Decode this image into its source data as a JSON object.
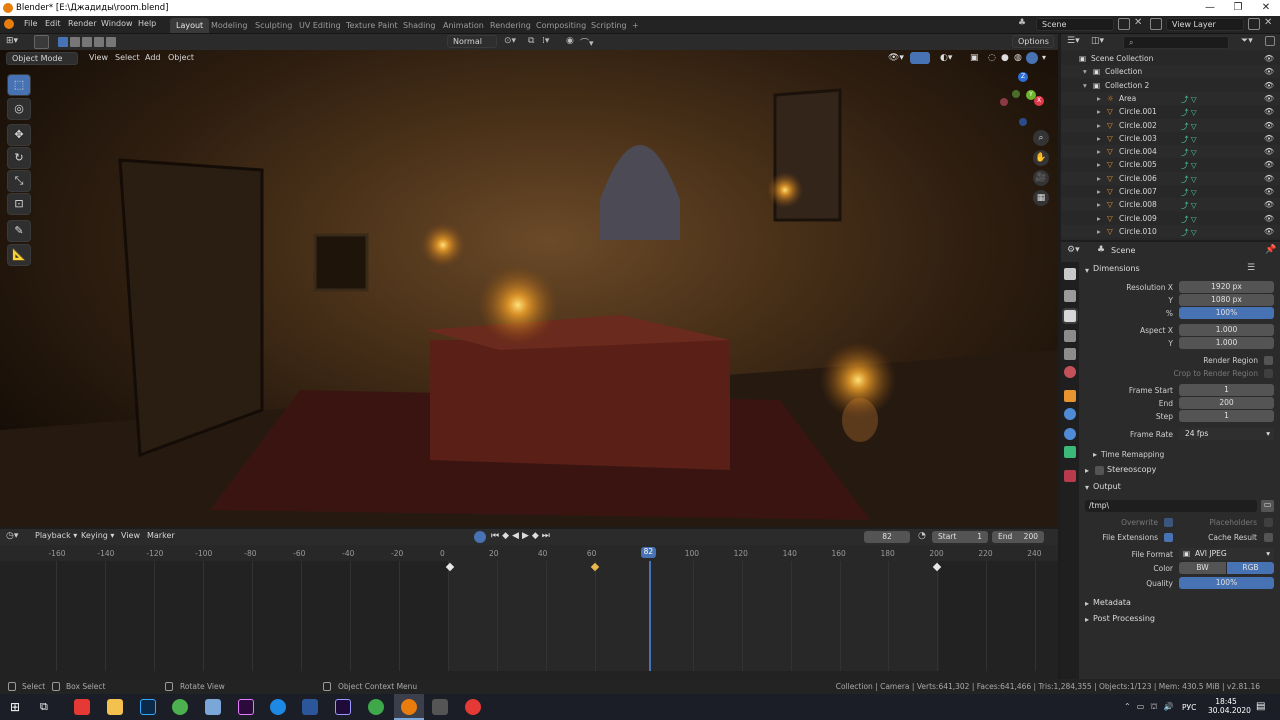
{
  "window": {
    "title": "Blender* [E:\\Джадиды\\room.blend]"
  },
  "topbar": {
    "menus": [
      "File",
      "Edit",
      "Render",
      "Window",
      "Help"
    ],
    "workspaces": [
      "Layout",
      "Modeling",
      "Sculpting",
      "UV Editing",
      "Texture Paint",
      "Shading",
      "Animation",
      "Rendering",
      "Compositing",
      "Scripting"
    ],
    "add_tab": "+",
    "scene_label": "Scene",
    "view_layer_label": "View Layer"
  },
  "viewport_header": {
    "orientation": "Normal",
    "options": "Options",
    "mode": "Object Mode",
    "menus": [
      "View",
      "Select",
      "Add",
      "Object"
    ]
  },
  "gizmo": {
    "x": "X",
    "y": "Y",
    "z": "Z"
  },
  "timeline": {
    "menus": [
      "Playback",
      "Keying",
      "View",
      "Marker"
    ],
    "current_frame": "82",
    "start_label": "Start",
    "start": "1",
    "end_label": "End",
    "end": "200",
    "ticks": [
      "-160",
      "-140",
      "-120",
      "-100",
      "-80",
      "-60",
      "-40",
      "-20",
      "0",
      "20",
      "40",
      "60",
      "82",
      "100",
      "120",
      "140",
      "160",
      "180",
      "200",
      "220",
      "240"
    ],
    "keyframes": [
      1,
      60,
      200
    ],
    "playhead_frame": 82
  },
  "outliner": {
    "search_placeholder": "",
    "rows": [
      {
        "name": "Scene Collection",
        "indent": 0
      },
      {
        "name": "Collection",
        "indent": 1
      },
      {
        "name": "Collection 2",
        "indent": 1
      },
      {
        "name": "Area",
        "indent": 2
      },
      {
        "name": "Circle.001",
        "indent": 2
      },
      {
        "name": "Circle.002",
        "indent": 2
      },
      {
        "name": "Circle.003",
        "indent": 2
      },
      {
        "name": "Circle.004",
        "indent": 2
      },
      {
        "name": "Circle.005",
        "indent": 2
      },
      {
        "name": "Circle.006",
        "indent": 2
      },
      {
        "name": "Circle.007",
        "indent": 2
      },
      {
        "name": "Circle.008",
        "indent": 2
      },
      {
        "name": "Circle.009",
        "indent": 2
      },
      {
        "name": "Circle.010",
        "indent": 2
      }
    ]
  },
  "properties": {
    "context": "Scene",
    "dimensions": {
      "header": "Dimensions",
      "res_x_label": "Resolution X",
      "res_x": "1920 px",
      "res_y_label": "Y",
      "res_y": "1080 px",
      "res_pct_label": "%",
      "res_pct": "100%",
      "aspect_x_label": "Aspect X",
      "aspect_x": "1.000",
      "aspect_y_label": "Y",
      "aspect_y": "1.000",
      "render_region": "Render Region",
      "crop_region": "Crop to Render Region",
      "frame_start_label": "Frame Start",
      "frame_start": "1",
      "end_label": "End",
      "end": "200",
      "step_label": "Step",
      "step": "1",
      "frame_rate_label": "Frame Rate",
      "frame_rate": "24 fps",
      "time_remapping": "Time Remapping"
    },
    "stereoscopy": "Stereoscopy",
    "output": {
      "header": "Output",
      "path": "/tmp\\",
      "overwrite": "Overwrite",
      "placeholders": "Placeholders",
      "file_extensions": "File Extensions",
      "cache_result": "Cache Result",
      "file_format_label": "File Format",
      "file_format": "AVI JPEG",
      "color_label": "Color",
      "color_bw": "BW",
      "color_rgb": "RGB",
      "quality_label": "Quality",
      "quality": "100%"
    },
    "metadata": "Metadata",
    "post_processing": "Post Processing"
  },
  "statusbar": {
    "select": "Select",
    "box_select": "Box Select",
    "rotate_view": "Rotate View",
    "context_menu": "Object Context Menu",
    "stats": "Collection | Camera | Verts:641,302 | Faces:641,466 | Tris:1,284,355 | Objects:1/123 | Mem: 430.5 MiB | v2.81.16"
  },
  "taskbar": {
    "lang": "РУС",
    "time": "18:45",
    "date": "30.04.2020"
  },
  "colors": {
    "accent": "#4772b3",
    "keyframe": "#e8b74a",
    "playhead": "#4772b3"
  }
}
